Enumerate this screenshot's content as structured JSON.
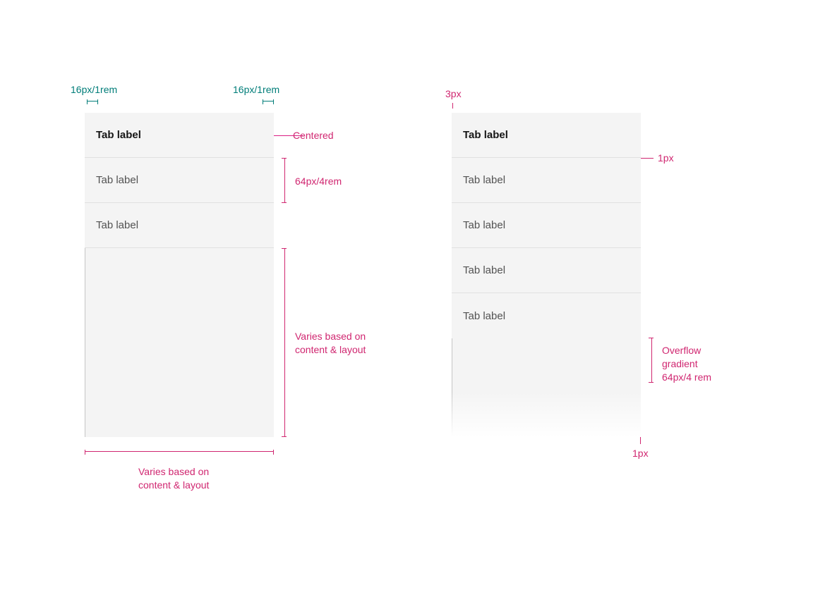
{
  "colors": {
    "teal": "#007d79",
    "magenta": "#d02670",
    "blue": "#0f62fe",
    "gray_bg": "#f4f4f4"
  },
  "left": {
    "tabs": [
      {
        "label": "Tab label",
        "active": true
      },
      {
        "label": "Tab label",
        "active": false
      },
      {
        "label": "Tab label",
        "active": false
      }
    ],
    "padding_left_label": "16px/1rem",
    "padding_right_label": "16px/1rem",
    "centered_label": "Centered",
    "row_height_label": "64px/4rem",
    "height_note": "Varies based on\ncontent & layout",
    "width_note": "Varies based on\ncontent & layout"
  },
  "right": {
    "tabs": [
      {
        "label": "Tab label",
        "active": true
      },
      {
        "label": "Tab label",
        "active": false
      },
      {
        "label": "Tab label",
        "active": false
      },
      {
        "label": "Tab label",
        "active": false
      },
      {
        "label": "Tab label",
        "active": false
      }
    ],
    "indicator_width_label": "3px",
    "divider_label": "1px",
    "border_label": "1px",
    "overflow_label": "Overflow\ngradient\n64px/4 rem"
  }
}
